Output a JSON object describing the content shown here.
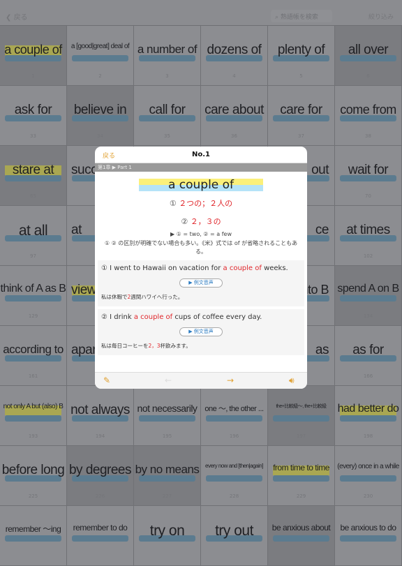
{
  "topbar": {
    "back": "戻る",
    "search_placeholder": "熟語帳を検索",
    "filter": "絞り込み"
  },
  "cells": [
    {
      "t": "a couple of",
      "n": "1",
      "dark": true,
      "hl": true,
      "s": 18
    },
    {
      "t": "a [good|great] deal of",
      "n": "2",
      "s": 10
    },
    {
      "t": "a number of",
      "n": "3",
      "s": 17
    },
    {
      "t": "dozens of",
      "n": "4",
      "s": 19
    },
    {
      "t": "plenty of",
      "n": "5",
      "s": 19
    },
    {
      "t": "all over",
      "n": "6",
      "dark": true,
      "s": 19
    },
    {
      "t": "ask for",
      "n": "33",
      "s": 19
    },
    {
      "t": "believe in",
      "n": "34",
      "dark": true,
      "s": 19
    },
    {
      "t": "call for",
      "n": "35",
      "s": 19
    },
    {
      "t": "care about",
      "n": "36",
      "s": 19
    },
    {
      "t": "care for",
      "n": "37",
      "s": 19
    },
    {
      "t": "come from",
      "n": "38",
      "s": 18
    },
    {
      "t": "stare at",
      "n": "65",
      "dark": true,
      "hl": true,
      "s": 19
    },
    {
      "t": "succ",
      "n": "",
      "s": 19
    },
    {
      "t": "",
      "n": ""
    },
    {
      "t": "",
      "n": ""
    },
    {
      "t": "out",
      "n": "",
      "s": 19,
      "r": true
    },
    {
      "t": "wait for",
      "n": "70",
      "s": 19
    },
    {
      "t": "at all",
      "n": "97",
      "s": 21
    },
    {
      "t": "at",
      "n": "",
      "s": 19
    },
    {
      "t": "",
      "n": ""
    },
    {
      "t": "",
      "n": ""
    },
    {
      "t": "ce",
      "n": "",
      "s": 19,
      "r": true
    },
    {
      "t": "at times",
      "n": "102",
      "s": 19
    },
    {
      "t": "think of A as B",
      "n": "129",
      "s": 16
    },
    {
      "t": "view",
      "n": "",
      "hl": true,
      "s": 19
    },
    {
      "t": "",
      "n": ""
    },
    {
      "t": "",
      "n": ""
    },
    {
      "t": "nto B",
      "n": "",
      "s": 18,
      "r": true
    },
    {
      "t": "spend A on B",
      "n": "134",
      "dark": true,
      "s": 16
    },
    {
      "t": "according to",
      "n": "161",
      "s": 17
    },
    {
      "t": "apar",
      "n": "",
      "s": 19
    },
    {
      "t": "",
      "n": ""
    },
    {
      "t": "",
      "n": ""
    },
    {
      "t": "as",
      "n": "",
      "s": 19,
      "r": true
    },
    {
      "t": "as for",
      "n": "166",
      "s": 19
    },
    {
      "t": "not only A but (also) B",
      "n": "193",
      "hl": true,
      "s": 10
    },
    {
      "t": "not always",
      "n": "194",
      "s": 19
    },
    {
      "t": "not necessarily",
      "n": "195",
      "s": 14
    },
    {
      "t": "one 〜, the other ...",
      "n": "196",
      "s": 11
    },
    {
      "t": "the+比較級〜, the+比較級",
      "n": "197",
      "dark": true,
      "s": 7
    },
    {
      "t": "had better do",
      "n": "198",
      "hl": true,
      "s": 16
    },
    {
      "t": "before long",
      "n": "225",
      "s": 19
    },
    {
      "t": "by degrees",
      "n": "226",
      "dark": true,
      "s": 19
    },
    {
      "t": "by no means",
      "n": "227",
      "dark": true,
      "s": 17
    },
    {
      "t": "every now and [then|again]",
      "n": "228",
      "s": 8
    },
    {
      "t": "from time to time",
      "n": "229",
      "hl": true,
      "s": 12
    },
    {
      "t": "(every) once in a while",
      "n": "230",
      "s": 10
    },
    {
      "t": "remember 〜ing",
      "n": "",
      "s": 12
    },
    {
      "t": "remember to do",
      "n": "",
      "s": 12
    },
    {
      "t": "try on",
      "n": "",
      "s": 21
    },
    {
      "t": "try out",
      "n": "",
      "s": 21
    },
    {
      "t": "be anxious about",
      "n": "",
      "dark": true,
      "s": 12
    },
    {
      "t": "be anxious to do",
      "n": "",
      "s": 12
    }
  ],
  "modal": {
    "back": "戻る",
    "title": "No.1",
    "breadcrumb": "第1章 ▶ Part 1",
    "word": "a couple of",
    "meaning1_marker": "①",
    "meaning1": "２つの；２人の",
    "meaning2_marker": "②",
    "meaning2": "２，３の",
    "note1": "▶ ① = two, ② = a few",
    "note2": "① ② の区別が明確でない場合も多い。《米》式では of が省略されることもある。",
    "examples": [
      {
        "pre": "① I went to Hawaii on vacation for ",
        "hl": "a couple of",
        "post": " weeks.",
        "play": "▶  例文音声",
        "ja_pre": "私は休暇で",
        "ja_hl": "2",
        "ja_post": "週間ハワイへ行った。"
      },
      {
        "pre": "② I drink ",
        "hl": "a couple of",
        "post": " cups of coffee every day.",
        "play": "▶  例文音声",
        "ja_pre": "私は毎日コーヒーを",
        "ja_hl": "2，3",
        "ja_post": "杯飲みます。"
      }
    ]
  },
  "colors": {
    "accent": "#e0a030",
    "red": "#e0262b",
    "highlight_yellow": "#fbf07a",
    "highlight_blue": "#b5e3f8"
  }
}
